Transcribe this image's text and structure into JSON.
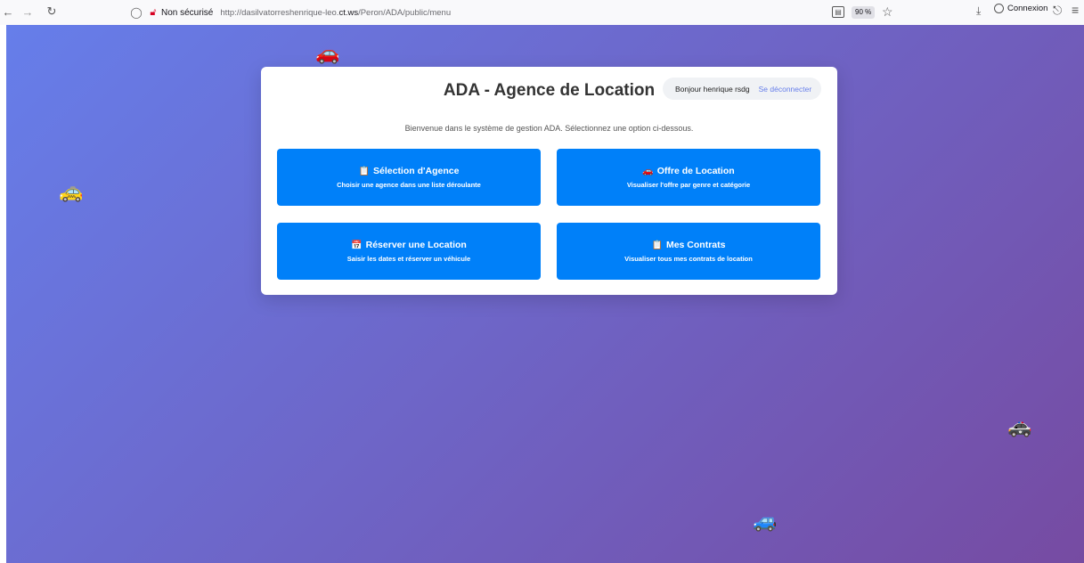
{
  "browser": {
    "insecure_label": "Non sécurisé",
    "url_prefix": "http://dasilvatorreshenrique-leo.",
    "url_domain": "ct.ws",
    "url_path": "/Peron/ADA/public/menu",
    "zoom": "90 %",
    "account_label": "Connexion"
  },
  "page": {
    "title": "ADA - Agence de Location",
    "user_greeting": "Bonjour henrique rsdg",
    "logout_label": "Se déconnecter",
    "welcome": "Bienvenue dans le système de gestion ADA. Sélectionnez une option ci-dessous."
  },
  "menu": [
    {
      "icon": "📋",
      "title": "Sélection d'Agence",
      "desc": "Choisir une agence dans une liste déroulante"
    },
    {
      "icon": "🚗",
      "title": "Offre de Location",
      "desc": "Visualiser l'offre par genre et catégorie"
    },
    {
      "icon": "📅",
      "title": "Réserver une Location",
      "desc": "Saisir les dates et réserver un véhicule"
    },
    {
      "icon": "📋",
      "title": "Mes Contrats",
      "desc": "Visualiser tous mes contrats de location"
    }
  ],
  "decorations": {
    "car_1": "🚗",
    "car_2": "🚕",
    "car_3": "🚓",
    "car_4": "🚙"
  },
  "colors": {
    "gradient_start": "#667eea",
    "gradient_end": "#764ba2",
    "button": "#0080f9",
    "link": "#667eea"
  }
}
